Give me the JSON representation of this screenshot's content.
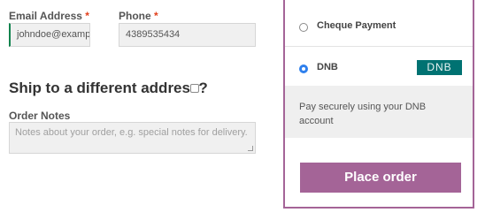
{
  "billing": {
    "email_label": "Email Address",
    "email_value": "johndoe@example.com",
    "phone_label": "Phone",
    "phone_value": "4389535434",
    "required_mark": "*"
  },
  "shipping": {
    "ship_different_label": "Ship to a different address?",
    "ship_different_checked": false
  },
  "notes": {
    "label": "Order Notes",
    "placeholder": "Notes about your order, e.g. special notes for delivery."
  },
  "payment": {
    "methods": [
      {
        "label": "Cheque Payment",
        "selected": false
      },
      {
        "label": "DNB",
        "selected": true,
        "logo_text": "DNB"
      }
    ],
    "description": "Pay securely using your DNB account",
    "place_order_label": "Place order"
  },
  "colors": {
    "accent": "#a46497",
    "dnb_logo": "#007272",
    "radio_checked": "#2f80ed",
    "valid_border": "#0f834d",
    "required": "#e2401c"
  }
}
